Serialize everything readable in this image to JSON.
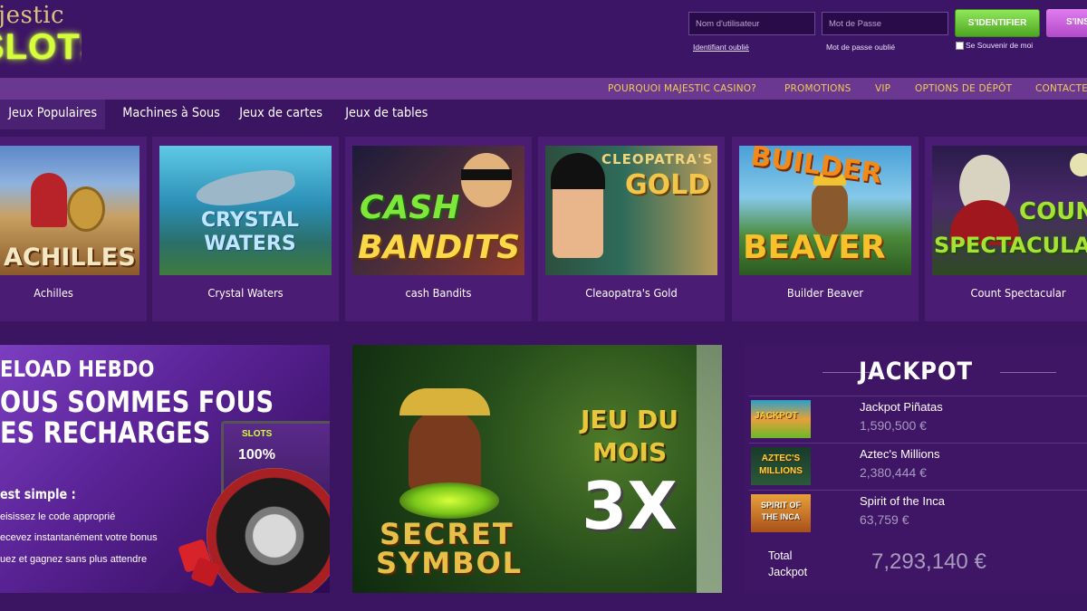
{
  "brand": {
    "line1": "ajestic",
    "line2": "SLOTS"
  },
  "login": {
    "username_placeholder": "Nom d'utilisateur",
    "password_placeholder": "Mot de Passe",
    "login_button": "S'IDENTIFIER",
    "register_button": "S'INS",
    "forgot_id": "Identifiant oublié",
    "forgot_password": "Mot de passe oublié",
    "remember_me": "Se Souvenir de moi"
  },
  "topnav": [
    "POURQUOI MAJESTIC CASINO?",
    "PROMOTIONS",
    "VIP",
    "OPTIONS DE DÉPÔT",
    "CONTACTEZ"
  ],
  "tabs": [
    "Jeux Populaires",
    "Machines à Sous",
    "Jeux de cartes",
    "Jeux de tables"
  ],
  "games": [
    {
      "title": "Achilles",
      "art": "ACHILLES"
    },
    {
      "title": "Crystal Waters",
      "art": "CRYSTAL WATERS"
    },
    {
      "title": "cash Bandits",
      "art1": "CASH",
      "art2": "BANDITS"
    },
    {
      "title": "Cleaopatra's Gold",
      "art1": "CLEOPATRA'S",
      "art2": "GOLD"
    },
    {
      "title": "Builder Beaver",
      "art1": "BUILDER",
      "art2": "BEAVER"
    },
    {
      "title": "Count Spectacular",
      "art1": "COUNT",
      "art2": "SPECTACULAR"
    }
  ],
  "promo_reload": {
    "line1": "ELOAD HEBDO",
    "line2": "OUS SOMMES FOUS",
    "line3": "ES RECHARGES",
    "intro": "est simple :",
    "steps": [
      "eisissez le code approprié",
      "ecevez instantanément votre bonus",
      "uez et gagnez sans plus attendre"
    ],
    "device_logo": "SLOTS",
    "device_bonus": "100%"
  },
  "promo_month": {
    "line1": "JEU DU",
    "line2": "MOIS",
    "multiplier": "3X",
    "game1": "SECRET",
    "game2": "SYMBOL"
  },
  "jackpot": {
    "title": "JACKPOT",
    "items": [
      {
        "name": "Jackpot Piñatas",
        "amount": "1,590,500 €",
        "art": "JACKPOT"
      },
      {
        "name": "Aztec's Millions",
        "amount": "2,380,444 €",
        "art": "AZTEC'S MILLIONS"
      },
      {
        "name": "Spirit of the Inca",
        "amount": "63,759 €",
        "art": "SPIRIT OF THE INCA"
      }
    ],
    "total_label_1": "Total",
    "total_label_2": "Jackpot",
    "total": "7,293,140 €"
  },
  "colors": {
    "background": "#3b1462",
    "nav_gold": "#f2cd52",
    "login_green": "#6cc83b",
    "register_pink": "#d26ae6"
  }
}
